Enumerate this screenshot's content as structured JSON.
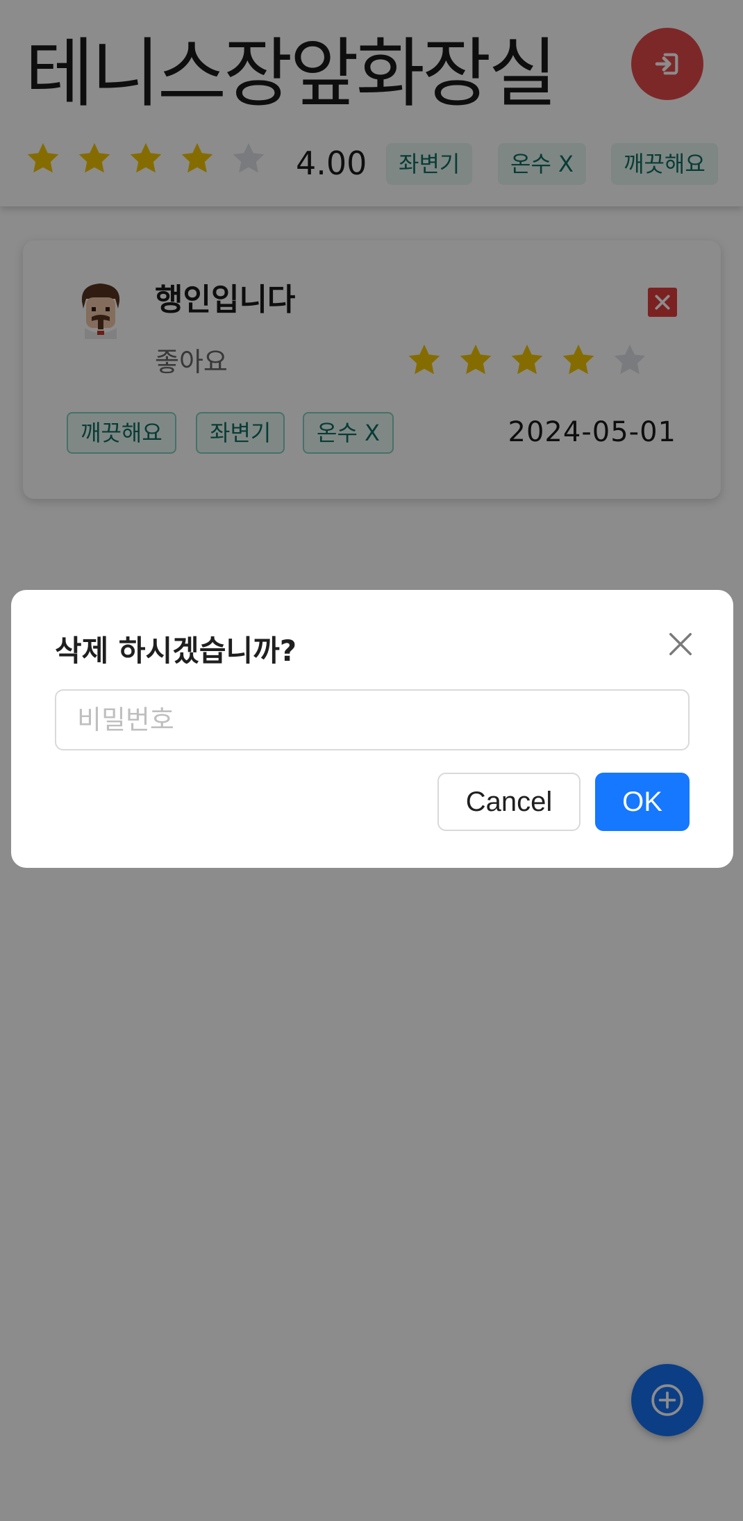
{
  "header": {
    "title": "테니스장앞화장실",
    "rating": "4.00",
    "rating_value": 4,
    "rating_max": 5,
    "tags": [
      "좌변기",
      "온수 X",
      "깨끗해요"
    ],
    "login_icon": "login-icon"
  },
  "review": {
    "author": "행인입니다",
    "comment": "좋아요",
    "rating_value": 4,
    "rating_max": 5,
    "tags": [
      "깨끗해요",
      "좌변기",
      "온수 X"
    ],
    "date": "2024-05-01",
    "delete_icon": "close-icon"
  },
  "modal": {
    "title": "삭제 하시겠습니까?",
    "password_placeholder": "비밀번호",
    "password_value": "",
    "cancel_label": "Cancel",
    "ok_label": "OK"
  },
  "fab": {
    "icon": "plus-circle-icon"
  },
  "colors": {
    "star_filled": "#f2c500",
    "star_empty": "#dfe1e6",
    "primary": "#1677ff",
    "danger": "#e44a4a",
    "tag_text": "#0f6d62"
  }
}
